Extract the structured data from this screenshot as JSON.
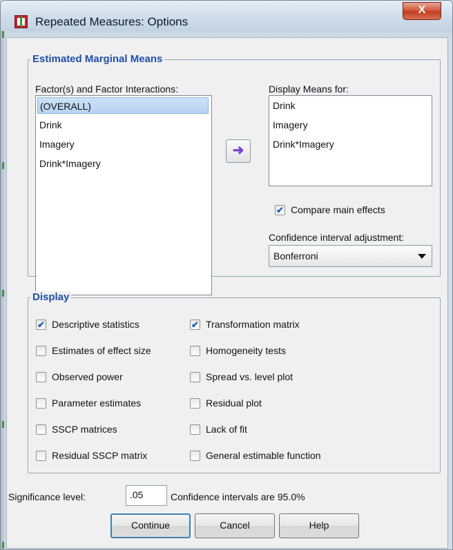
{
  "window": {
    "title": "Repeated Measures: Options",
    "close_glyph": "X"
  },
  "emm": {
    "title": "Estimated Marginal Means",
    "factors_label": "Factor(s) and Factor Interactions:",
    "factors": [
      "(OVERALL)",
      "Drink",
      "Imagery",
      "Drink*Imagery"
    ],
    "selected_factor": "(OVERALL)",
    "display_label": "Display Means for:",
    "display_items": [
      "Drink",
      "Imagery",
      "Drink*Imagery"
    ],
    "move_glyph": "➜",
    "compare_label": "Compare main effects",
    "compare_checked": true,
    "ci_label": "Confidence interval adjustment:",
    "ci_value": "Bonferroni"
  },
  "display": {
    "title": "Display",
    "left": [
      {
        "label": "Descriptive statistics",
        "checked": true
      },
      {
        "label": "Estimates of effect size",
        "checked": false
      },
      {
        "label": "Observed power",
        "checked": false
      },
      {
        "label": "Parameter estimates",
        "checked": false
      },
      {
        "label": "SSCP matrices",
        "checked": false
      },
      {
        "label": "Residual SSCP matrix",
        "checked": false
      }
    ],
    "right": [
      {
        "label": "Transformation matrix",
        "checked": true
      },
      {
        "label": "Homogeneity tests",
        "checked": false
      },
      {
        "label": "Spread vs. level plot",
        "checked": false
      },
      {
        "label": "Residual plot",
        "checked": false
      },
      {
        "label": "Lack of fit",
        "checked": false
      },
      {
        "label": "General estimable function",
        "checked": false
      }
    ]
  },
  "significance": {
    "label": "Significance level:",
    "value": ".05",
    "ci_text": "Confidence intervals are 95.0%"
  },
  "buttons": {
    "continue": "Continue",
    "cancel": "Cancel",
    "help": "Help"
  },
  "check_glyph": "✔"
}
